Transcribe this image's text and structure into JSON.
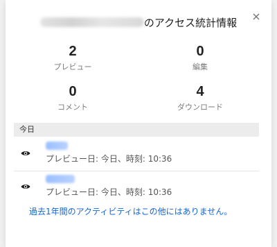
{
  "dialog": {
    "title_suffix": "のアクセス統計情報",
    "close_label": "×"
  },
  "stats": [
    {
      "value": "2",
      "label": "プレビュー"
    },
    {
      "value": "0",
      "label": "編集"
    },
    {
      "value": "0",
      "label": "コメント"
    },
    {
      "value": "4",
      "label": "ダウンロード"
    }
  ],
  "activity": {
    "section_title": "今日",
    "entries": [
      {
        "detail": "プレビュー日: 今日、時刻: 10:36"
      },
      {
        "detail": "プレビュー日: 今日、時刻: 10:36"
      }
    ],
    "footer_note": "過去1年間のアクティビティはこの他にはありません。"
  },
  "colors": {
    "link_blue": "#1565d8",
    "section_bg": "#ececec"
  },
  "icons": {
    "close": "close-icon",
    "entry": "eye-icon"
  }
}
